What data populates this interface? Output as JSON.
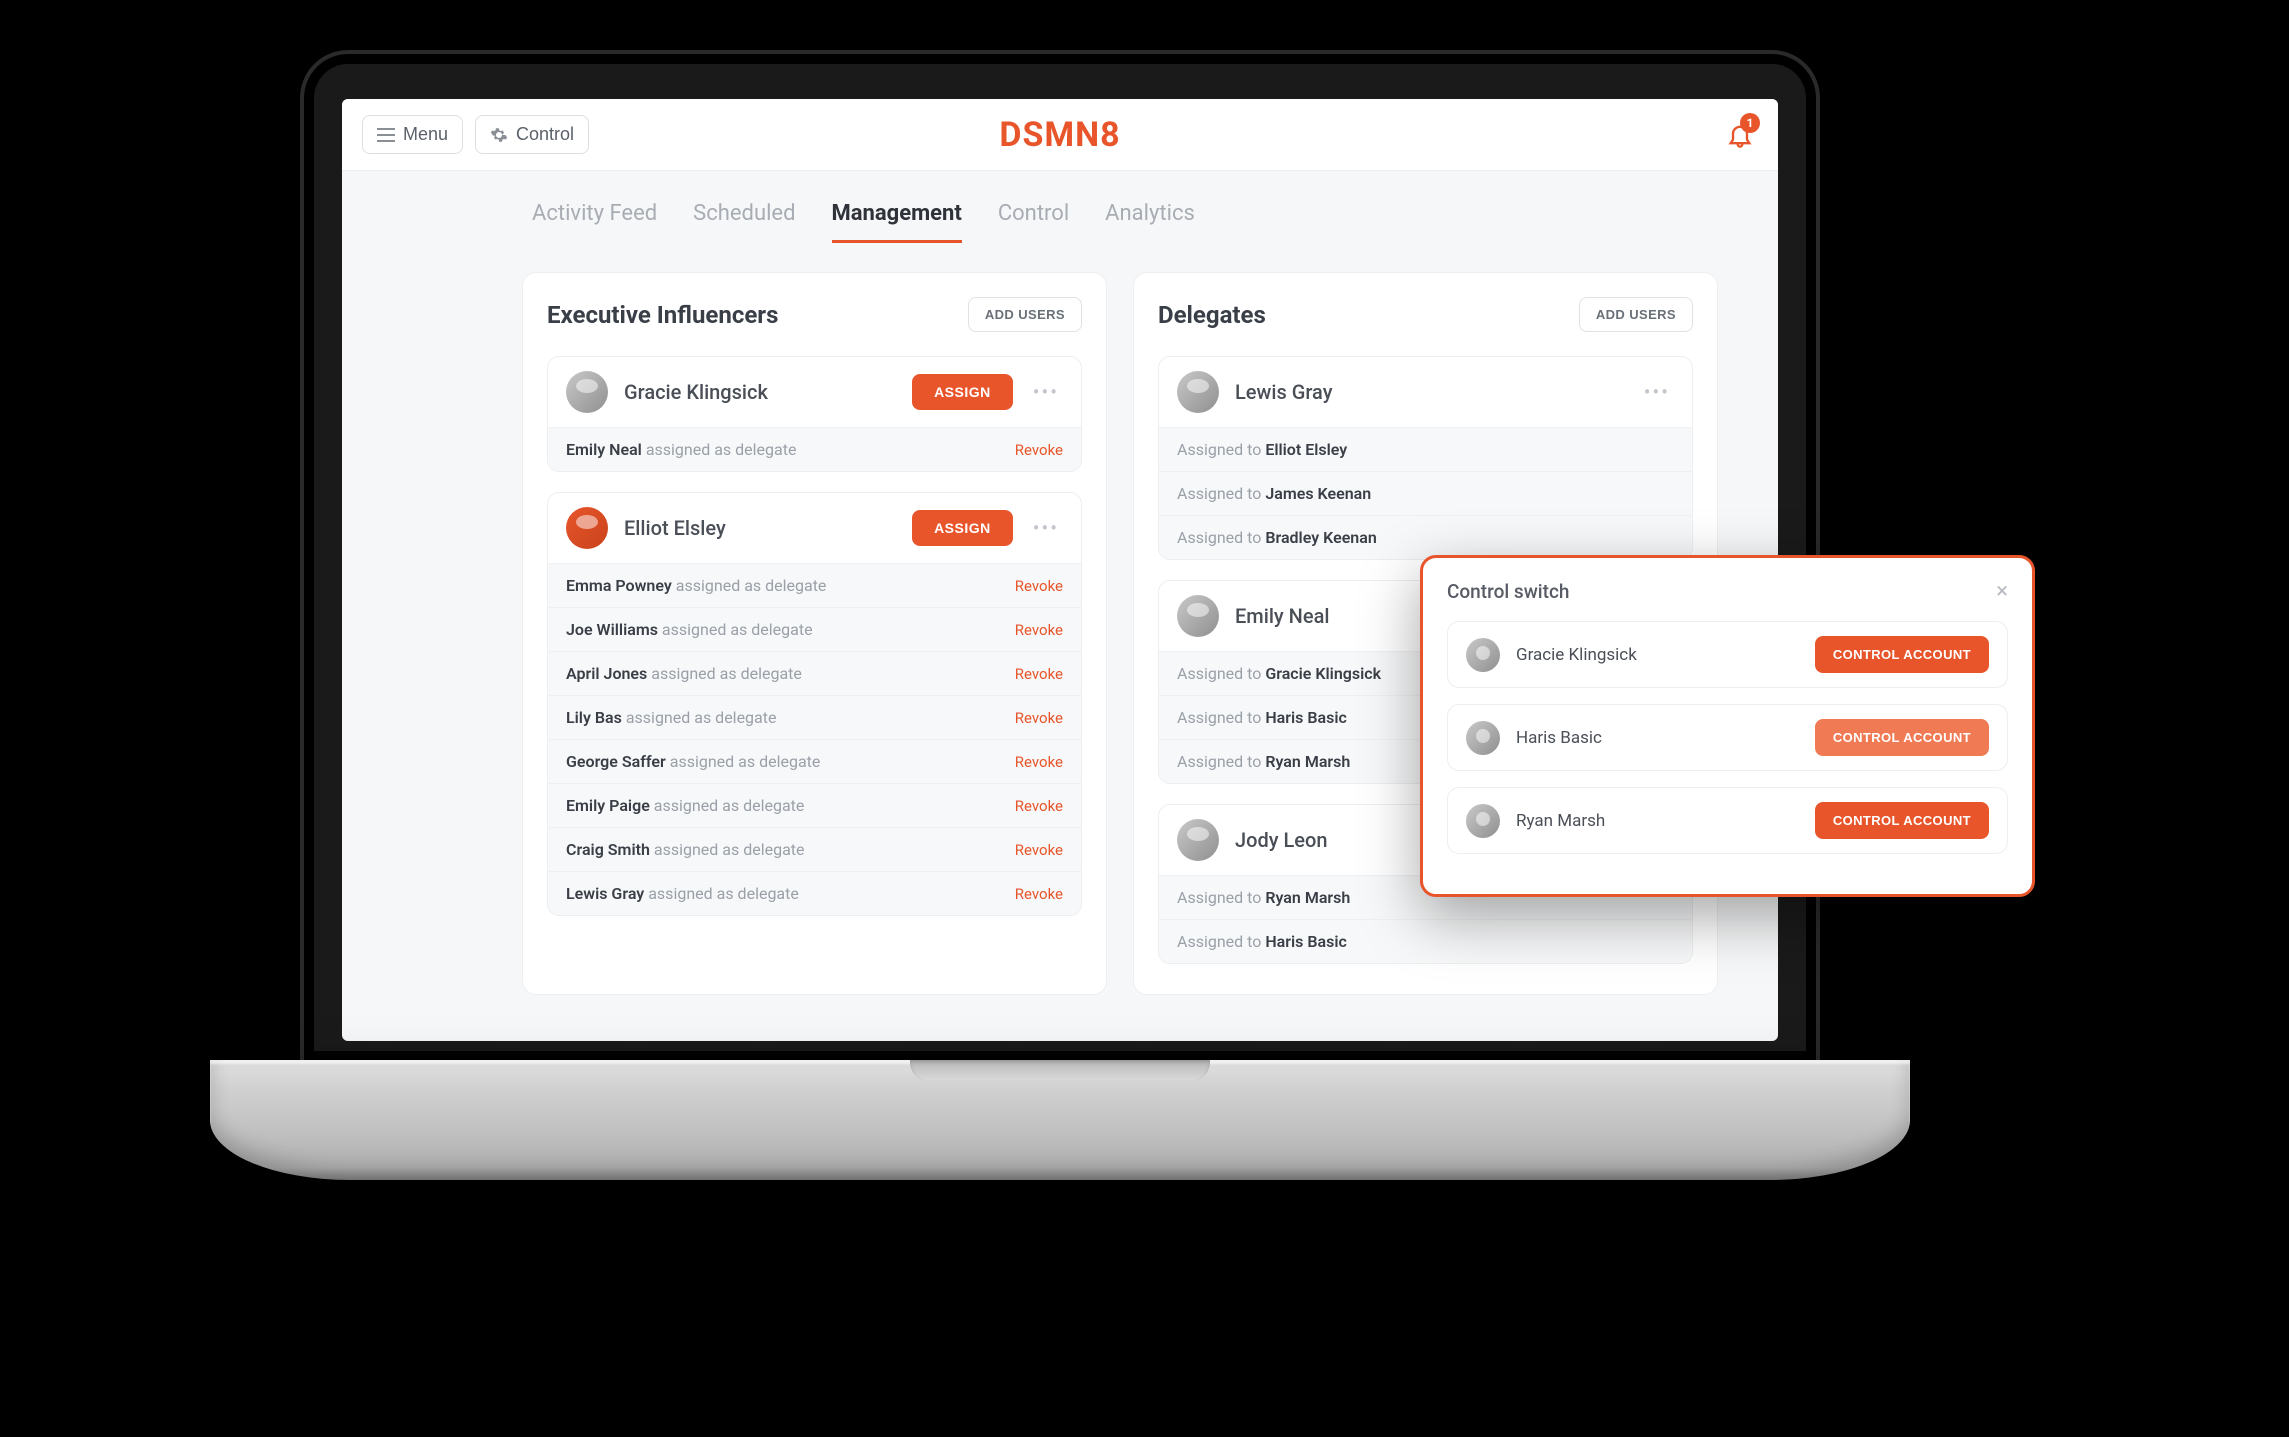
{
  "brand": "DSMN8",
  "topbar": {
    "menu_label": "Menu",
    "control_label": "Control",
    "notification_count": "1"
  },
  "tabs": [
    {
      "label": "Activity Feed",
      "active": false
    },
    {
      "label": "Scheduled",
      "active": false
    },
    {
      "label": "Management",
      "active": true
    },
    {
      "label": "Control",
      "active": false
    },
    {
      "label": "Analytics",
      "active": false
    }
  ],
  "panels": {
    "executives": {
      "title": "Executive Influencers",
      "add_label": "ADD USERS",
      "assign_label": "ASSIGN",
      "revoke_label": "Revoke",
      "delegate_phrase": "assigned as delegate",
      "cards": [
        {
          "name": "Gracie Klingsick",
          "delegates": [
            "Emily Neal"
          ]
        },
        {
          "name": "Elliot Elsley",
          "delegates": [
            "Emma Powney",
            "Joe Williams",
            "April Jones",
            "Lily Bas",
            "George Saffer",
            "Emily Paige",
            "Craig Smith",
            "Lewis Gray"
          ]
        }
      ]
    },
    "delegates": {
      "title": "Delegates",
      "add_label": "ADD USERS",
      "assigned_phrase": "Assigned to",
      "cards": [
        {
          "name": "Lewis Gray",
          "assigned_to": [
            "Elliot Elsley",
            "James Keenan",
            "Bradley Keenan"
          ]
        },
        {
          "name": "Emily Neal",
          "assigned_to": [
            "Gracie Klingsick",
            "Haris Basic",
            "Ryan Marsh"
          ]
        },
        {
          "name": "Jody Leon",
          "assigned_to": [
            "Ryan Marsh",
            "Haris Basic"
          ]
        }
      ]
    }
  },
  "popup": {
    "title": "Control switch",
    "button_label": "CONTROL ACCOUNT",
    "accounts": [
      "Gracie Klingsick",
      "Haris Basic",
      "Ryan Marsh"
    ]
  }
}
